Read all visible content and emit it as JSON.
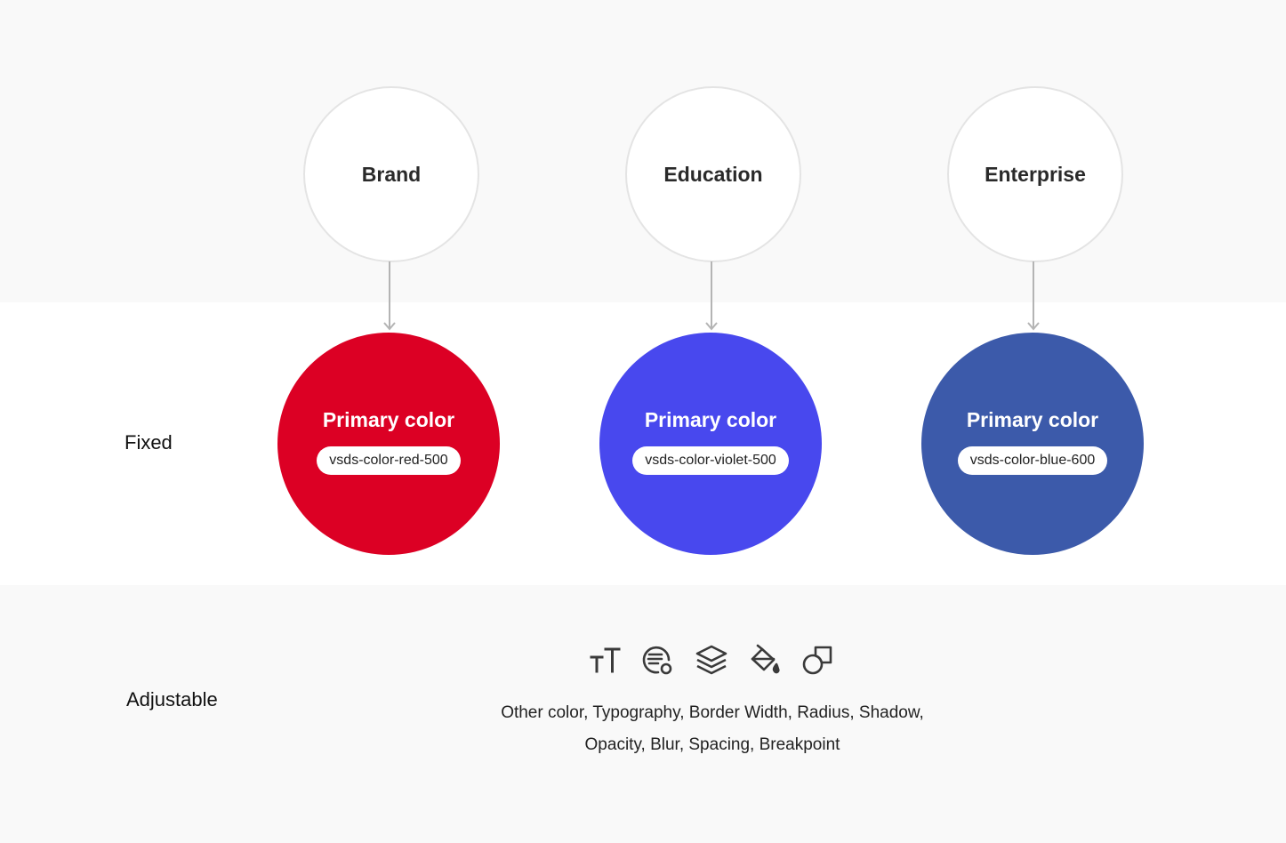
{
  "products": [
    {
      "name": "Brand",
      "primary_label": "Primary color",
      "token": "vsds-color-red-500",
      "color": "#dc0024"
    },
    {
      "name": "Education",
      "primary_label": "Primary color",
      "token": "vsds-color-violet-500",
      "color": "#4848ee"
    },
    {
      "name": "Enterprise",
      "primary_label": "Primary color",
      "token": "vsds-color-blue-600",
      "color": "#3c5aaa"
    }
  ],
  "rows": {
    "fixed_label": "Fixed",
    "adjustable_label": "Adjustable"
  },
  "adjustable": {
    "icons": [
      "typography-icon",
      "color-swatch-icon",
      "layers-icon",
      "paint-bucket-icon",
      "shapes-icon"
    ],
    "line1": "Other color, Typography,  Border Width,  Radius,  Shadow,",
    "line2": "Opacity,  Blur,  Spacing,  Breakpoint"
  },
  "colors": {
    "band_gray": "#f9f9f9",
    "circle_border": "#e4e4e4",
    "connector": "#b4b4b4",
    "icon": "#3a3a3a"
  }
}
